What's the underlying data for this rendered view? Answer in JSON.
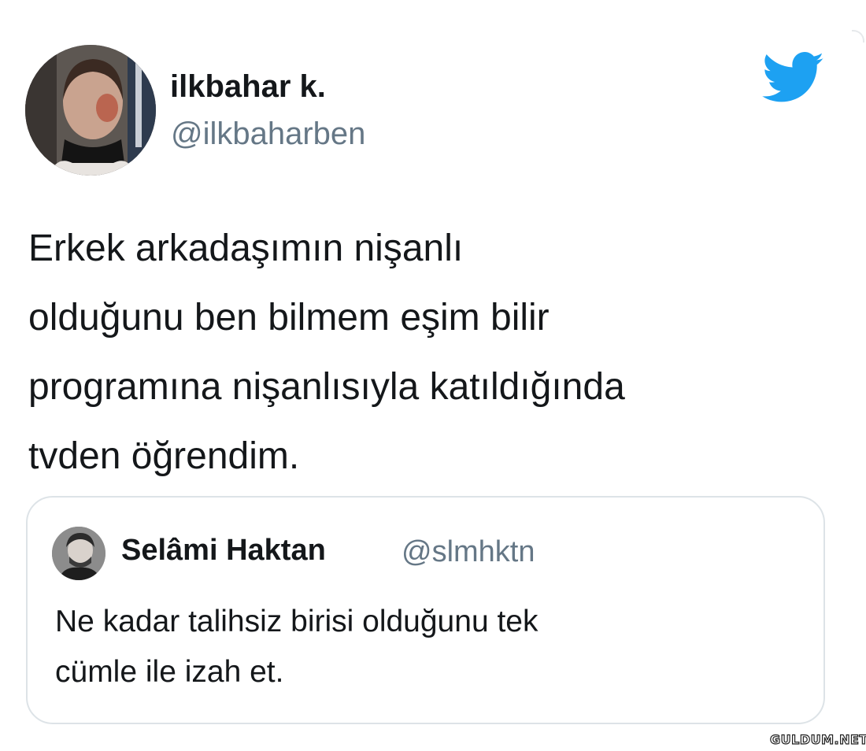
{
  "tweet": {
    "display_name": "ilkbahar k.",
    "handle": "@ilkbaharben",
    "icon": "twitter-bird-icon",
    "text_lines": [
      "Erkek arkadaşımın nişanlı",
      "olduğunu ben bilmem eşim bilir",
      "programına nişanlısıyla katıldığında",
      "tvden öğrendim."
    ]
  },
  "quoted_tweet": {
    "display_name": "Selâmi Haktan",
    "handle": "@slmhktn",
    "text_lines": [
      "Ne kadar talihsiz birisi olduğunu tek",
      "cümle ile izah et."
    ]
  },
  "watermark": {
    "text": "GULDUM.NET"
  },
  "colors": {
    "twitter_blue": "#1da1f2",
    "text": "#14171a",
    "secondary_text": "#657786",
    "border": "#dde3e7"
  }
}
